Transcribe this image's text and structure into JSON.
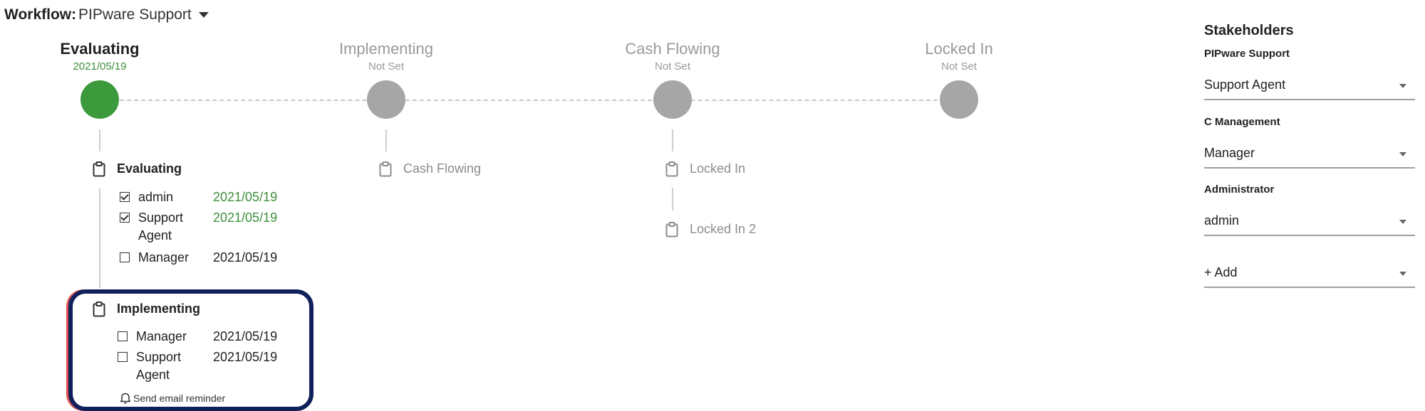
{
  "workflow": {
    "label": "Workflow:",
    "selected": "PIPware Support"
  },
  "stages": [
    {
      "title": "Evaluating",
      "date": "2021/05/19",
      "active": true
    },
    {
      "title": "Implementing",
      "date": "Not Set",
      "active": false
    },
    {
      "title": "Cash Flowing",
      "date": "Not Set",
      "active": false
    },
    {
      "title": "Locked In",
      "date": "Not Set",
      "active": false
    }
  ],
  "evaluating_task": {
    "title": "Evaluating",
    "rows": [
      {
        "name": "admin",
        "date": "2021/05/19",
        "checked": true
      },
      {
        "name_line1": "Support",
        "name_line2": "Agent",
        "date": "2021/05/19",
        "checked": true
      },
      {
        "name": "Manager",
        "date": "2021/05/19",
        "checked": false
      }
    ]
  },
  "implementing_task": {
    "title": "Implementing",
    "rows": [
      {
        "name": "Manager",
        "date": "2021/05/19",
        "checked": false
      },
      {
        "name_line1": "Support",
        "name_line2": "Agent",
        "date": "2021/05/19",
        "checked": false
      }
    ],
    "reminder": "Send email reminder"
  },
  "cash_flowing_task": {
    "title": "Cash Flowing"
  },
  "locked_in_tasks": [
    {
      "title": "Locked In"
    },
    {
      "title": "Locked In 2"
    }
  ],
  "stakeholders": {
    "title": "Stakeholders",
    "groups": [
      {
        "label": "PIPware Support",
        "value": "Support Agent"
      },
      {
        "label": "C Management",
        "value": "Manager"
      },
      {
        "label": "Administrator",
        "value": "admin"
      }
    ],
    "add_label": "+ Add"
  },
  "colors": {
    "active": "#3c9a3c",
    "inactive": "#a6a6a6",
    "highlight": "#10205a",
    "date_green": "#3d8f3d"
  },
  "icons": {
    "task": "clipboard-icon",
    "reminder": "bell-icon",
    "dropdown": "caret-down-icon"
  }
}
